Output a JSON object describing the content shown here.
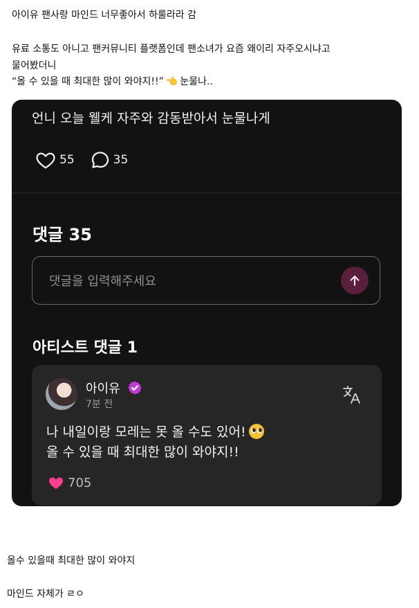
{
  "post": {
    "title": "아이유 팬사랑 마인드 너무좋아서 하룰라라 감",
    "line1": "유료 소통도 아니고 팬커뮤니티 플랫폼인데 팬소녀가 요즘 왜이리 자주오시냐고",
    "line2": "물어봤더니",
    "line3": "“올 수 있을 때 최대한 많이 와야지!!”",
    "line3_suffix": "눈물나..",
    "pointing_icon": "pointing-left-hand-icon"
  },
  "app": {
    "post_text": "언니 오늘 웰케 자주와 감동받아서 눈물나게",
    "like_count": "55",
    "comment_count": "35",
    "comments_heading": "댓글 35",
    "input_placeholder": "댓글을 입력해주세요",
    "artist_heading": "아티스트 댓글 1",
    "artist_comment": {
      "author": "아이유",
      "time": "7분 전",
      "line1": "나 내일이랑 모레는 못 올 수도 있어!",
      "line2": "올 수 있을 때 최대한 많이 와야지!!",
      "likes": "705"
    },
    "colors": {
      "background": "#121212",
      "card": "#262626",
      "accent_pink": "#ff3d8b",
      "verified_purple": "#c23bd8",
      "send_button": "#5a1f3a"
    }
  },
  "footer": {
    "line1": "올수 있을때 최대한 많이 와야지",
    "line2": "마인드 자체가 ㄹㅇ"
  }
}
